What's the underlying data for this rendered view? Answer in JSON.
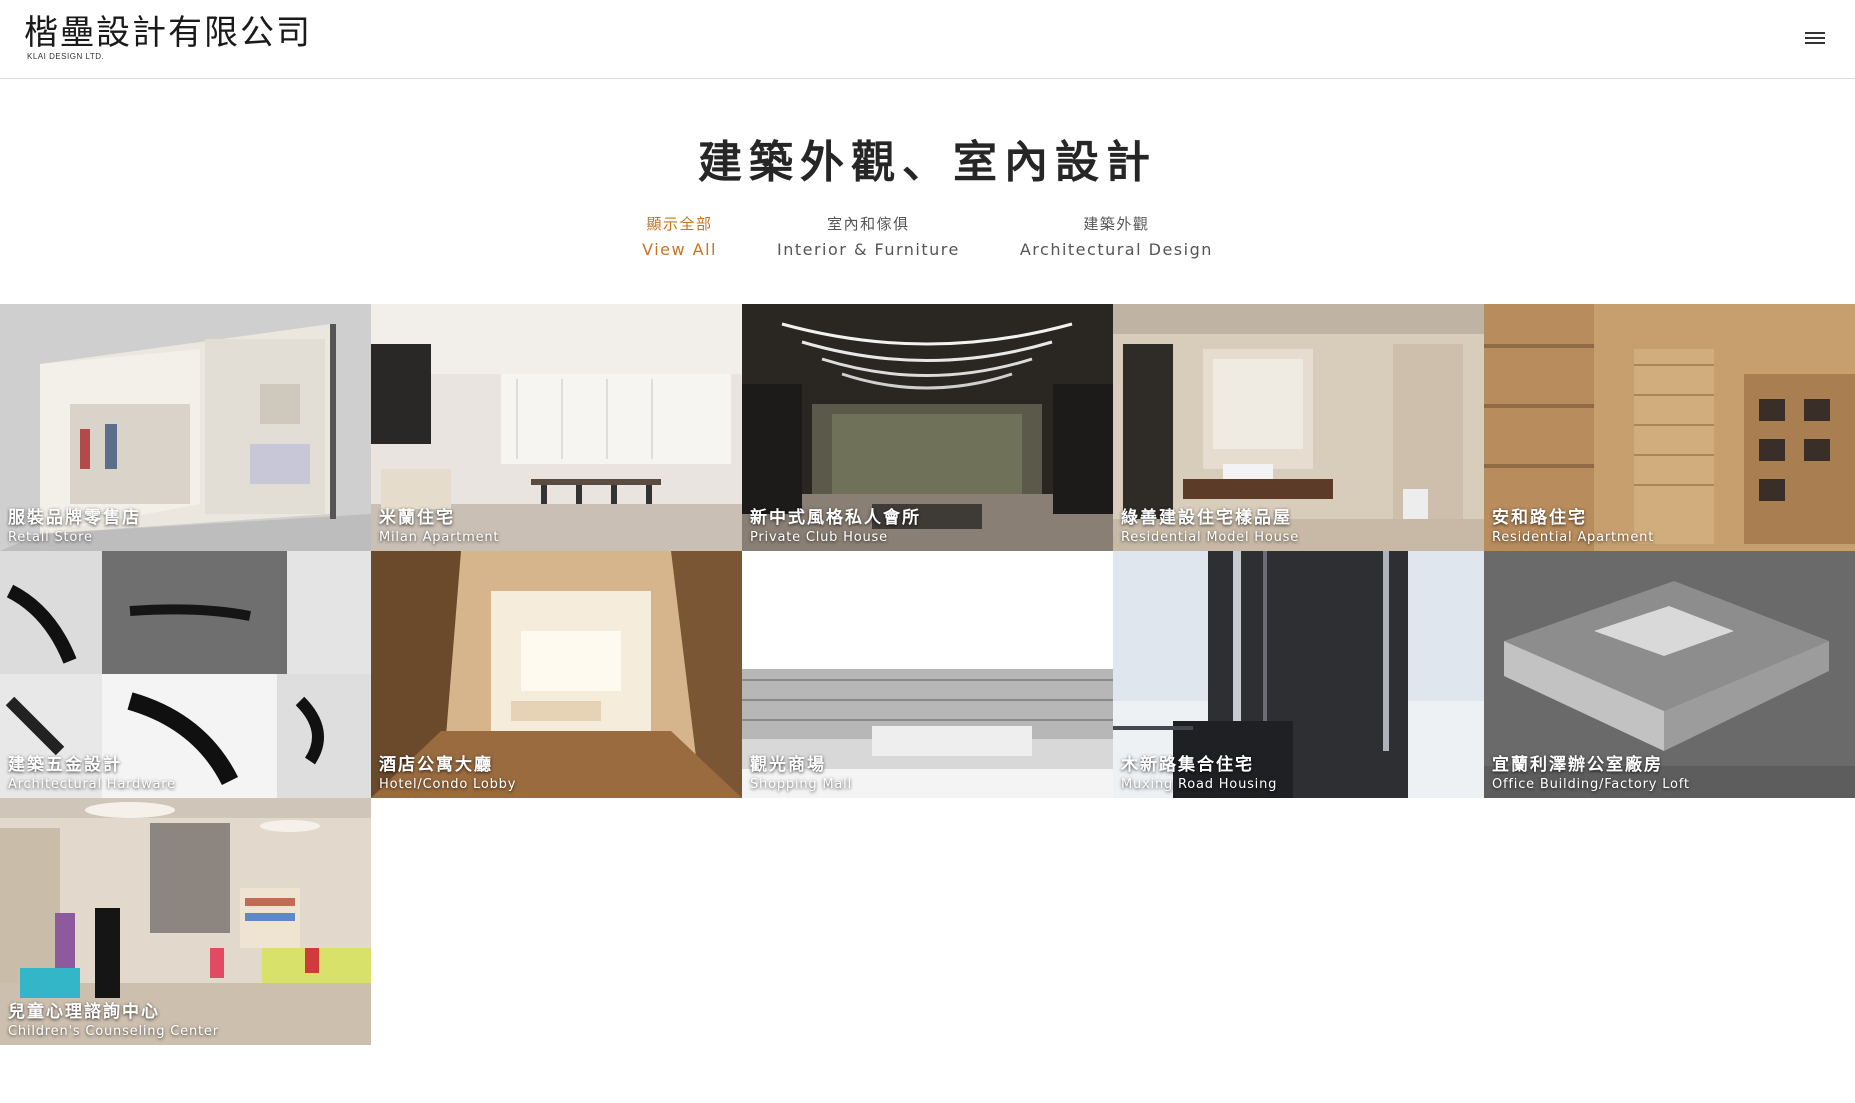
{
  "header": {
    "logo_cn": "楷壘設計有限公司",
    "logo_en": "KLAI DESIGN LTD.",
    "menu_icon": "hamburger-icon"
  },
  "page": {
    "title": "建築外觀、室內設計"
  },
  "filters": [
    {
      "cn": "顯示全部",
      "en": "View All",
      "active": true
    },
    {
      "cn": "室內和傢俱",
      "en": "Interior & Furniture",
      "active": false
    },
    {
      "cn": "建築外觀",
      "en": "Architectural Design",
      "active": false
    }
  ],
  "colors": {
    "accent": "#c8731f",
    "text": "#262626",
    "muted": "#555555"
  },
  "projects": [
    {
      "cn": "服裝品牌零售店",
      "en": "Retail Store"
    },
    {
      "cn": "米蘭住宅",
      "en": "Milan Apartment"
    },
    {
      "cn": "新中式風格私人會所",
      "en": "Private Club House"
    },
    {
      "cn": "綠善建設住宅樣品屋",
      "en": "Residential Model House"
    },
    {
      "cn": "安和路住宅",
      "en": "Residential Apartment"
    },
    {
      "cn": "建築五金設計",
      "en": "Architectural Hardware"
    },
    {
      "cn": "酒店公寓大廳",
      "en": "Hotel/Condo Lobby"
    },
    {
      "cn": "觀光商場",
      "en": "Shopping Mall"
    },
    {
      "cn": "木新路集合住宅",
      "en": "Muxing Road Housing"
    },
    {
      "cn": "宜蘭利澤辦公室廠房",
      "en": "Office Building/Factory Loft"
    },
    {
      "cn": "兒童心理諮詢中心",
      "en": "Children's Counseling Center"
    }
  ]
}
